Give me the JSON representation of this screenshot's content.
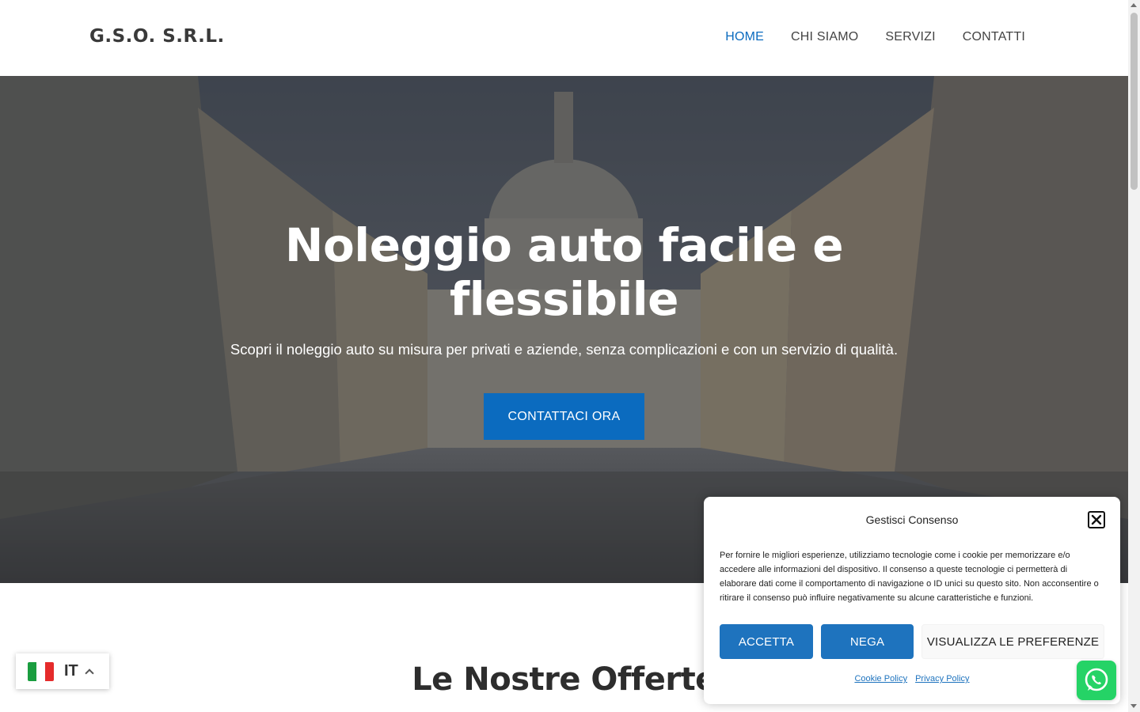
{
  "header": {
    "logo": "G.S.O. S.R.L.",
    "nav": [
      {
        "label": "HOME",
        "active": true
      },
      {
        "label": "CHI SIAMO",
        "active": false
      },
      {
        "label": "SERVIZI",
        "active": false
      },
      {
        "label": "CONTATTI",
        "active": false
      }
    ]
  },
  "hero": {
    "title_line1": "Noleggio auto facile e",
    "title_line2": "flessibile",
    "subtitle": "Scopri il noleggio auto su misura per privati e aziende, senza complicazioni e con un servizio di qualità.",
    "cta_label": "CONTATTACI ORA"
  },
  "offers": {
    "title": "Le Nostre Offerte"
  },
  "language": {
    "code": "IT",
    "flag_icon": "italy-flag-icon"
  },
  "consent": {
    "title": "Gestisci Consenso",
    "text": "Per fornire le migliori esperienze, utilizziamo tecnologie come i cookie per memorizzare e/o accedere alle informazioni del dispositivo. Il consenso a queste tecnologie ci permetterà di elaborare dati come il comportamento di navigazione o ID unici su questo sito. Non acconsentire o ritirare il consenso può influire negativamente su alcune caratteristiche e funzioni.",
    "accept_label": "ACCETTA",
    "deny_label": "NEGA",
    "prefs_label": "VISUALIZZA LE PREFERENZE",
    "cookie_policy_label": "Cookie Policy",
    "privacy_policy_label": "Privacy Policy"
  },
  "colors": {
    "accent": "#0b6bbf",
    "consent_button": "#1e73be",
    "whatsapp": "#25d366"
  }
}
